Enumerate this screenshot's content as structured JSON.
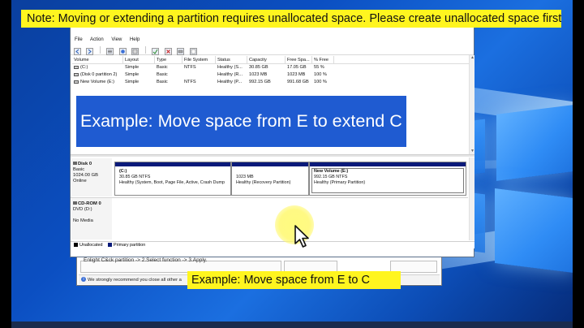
{
  "banner": {
    "text": "Note: Moving or extending a partition requires unallocated space. Please create unallocated space first."
  },
  "window": {
    "title": "Disk Management",
    "menu": [
      "File",
      "Action",
      "View",
      "Help"
    ]
  },
  "volume_table": {
    "columns": [
      "Volume",
      "Layout",
      "Type",
      "File System",
      "Status",
      "Capacity",
      "Free Spa...",
      "% Free"
    ],
    "rows": [
      [
        "(C:)",
        "Simple",
        "Basic",
        "NTFS",
        "Healthy (S...",
        "30.85 GB",
        "17.05 GB",
        "55 %"
      ],
      [
        "(Disk 0 partition 2)",
        "Simple",
        "Basic",
        "",
        "Healthy (R...",
        "1023 MB",
        "1023 MB",
        "100 %"
      ],
      [
        "New Volume (E:)",
        "Simple",
        "Basic",
        "NTFS",
        "Healthy (P...",
        "992.15 GB",
        "991.68 GB",
        "100 %"
      ]
    ]
  },
  "overlay": {
    "text": "Example: Move space from E to extend C drive"
  },
  "disks": {
    "disk0": {
      "name": "Disk 0",
      "type": "Basic",
      "size": "1024.00 GB",
      "status": "Online"
    },
    "cdrom": {
      "name": "CD-ROM 0",
      "drive": "DVD (D:)",
      "media": "No Media"
    }
  },
  "partitions": [
    {
      "title": "(C:)",
      "size": "30.85 GB NTFS",
      "status": "Healthy (System, Boot, Page File, Active, Crash Dump"
    },
    {
      "title": "",
      "size": "1023 MB",
      "status": "Healthy (Recovery Partition)"
    },
    {
      "title": "New Volume  (E:)",
      "size": "992.15 GB NTFS",
      "status": "Healthy (Primary Partition)"
    }
  ],
  "legend": {
    "unallocated": "Unallocated",
    "primary": "Primary partition"
  },
  "back_dialog": {
    "top_text": "Enlight C&ck partition -> 2.Select function -> 3.Apply.",
    "bottom_text": "We strongly recommend you close all other a"
  },
  "caption": {
    "text": "Example: Move space from E to C"
  }
}
